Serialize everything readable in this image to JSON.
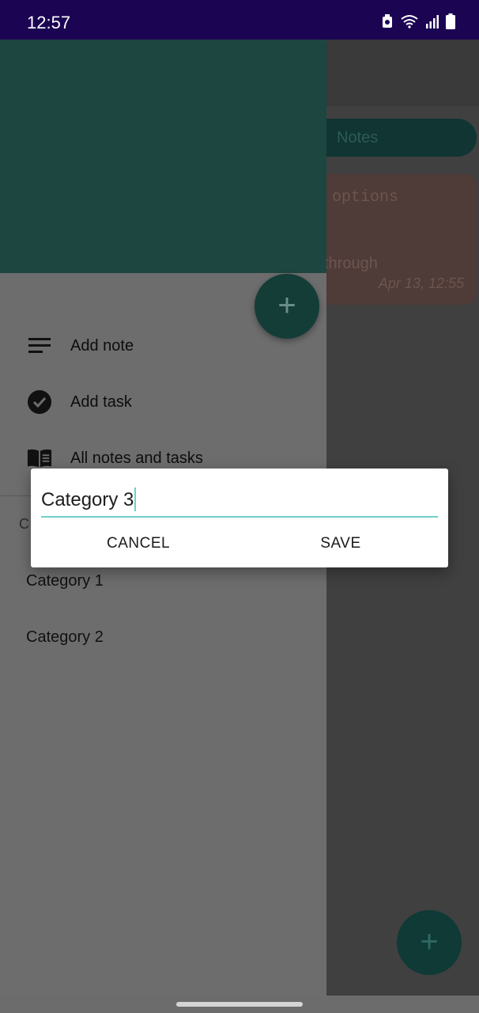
{
  "status_bar": {
    "time": "12:57",
    "icons": [
      "recycle-icon",
      "wifi-icon",
      "signal-icon",
      "battery-icon"
    ]
  },
  "background": {
    "tab_label": "Notes",
    "note_card": {
      "line1": "options",
      "line2": "through",
      "date": "Apr 13, 12:55"
    }
  },
  "drawer": {
    "items": [
      {
        "label": "Add note",
        "icon": "notes-lines-icon"
      },
      {
        "label": "Add task",
        "icon": "check-circle-icon"
      },
      {
        "label": "All notes and tasks",
        "icon": "book-icon"
      }
    ],
    "categories_header": "C",
    "categories": [
      "Category 1",
      "Category 2"
    ]
  },
  "dialog": {
    "input_value": "Category 3",
    "cancel_label": "CANCEL",
    "save_label": "SAVE"
  },
  "colors": {
    "status_bar": "#1b0553",
    "drawer_header": "#1d4640",
    "accent": "#6fd0c7"
  }
}
